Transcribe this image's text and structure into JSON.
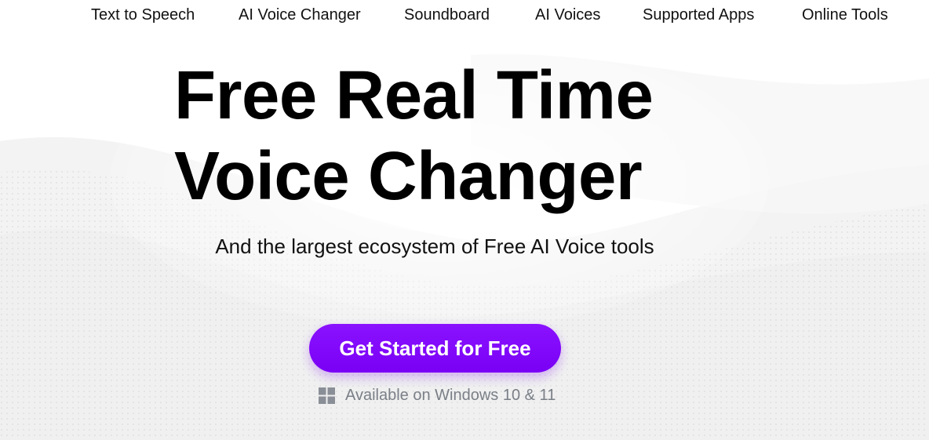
{
  "nav": {
    "items": [
      {
        "label": "Text to Speech"
      },
      {
        "label": "AI Voice Changer"
      },
      {
        "label": "Soundboard"
      },
      {
        "label": "AI Voices"
      },
      {
        "label": "Supported Apps"
      },
      {
        "label": "Online Tools"
      }
    ]
  },
  "hero": {
    "title_line1": "Free Real Time",
    "title_line2": "Voice Changer",
    "subtitle": "And the largest ecosystem of Free AI Voice tools",
    "cta_label": "Get Started for Free",
    "availability": "Available on Windows 10 & 11",
    "availability_icon": "windows-icon"
  },
  "colors": {
    "accent": "#7a00f5",
    "text": "#000000",
    "muted": "#7a7f87"
  }
}
